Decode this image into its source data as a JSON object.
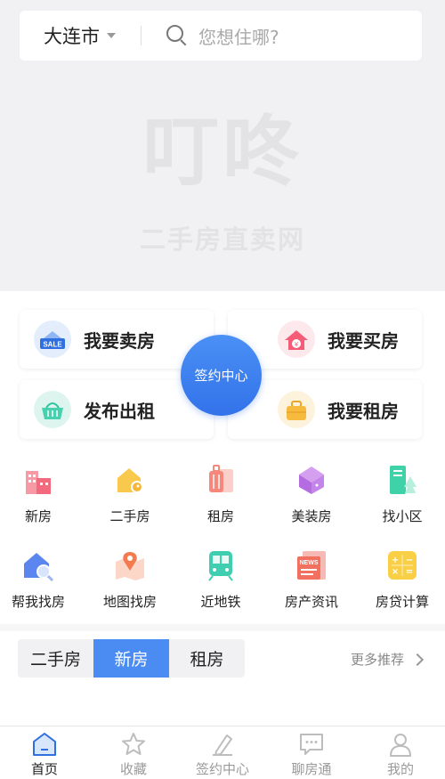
{
  "header": {
    "city": "大连市",
    "search_placeholder": "您想住哪?"
  },
  "brand": {
    "logo_text": "叮咚",
    "subtitle": "二手房直卖网"
  },
  "cards": [
    {
      "label": "我要卖房",
      "icon": "sale-icon"
    },
    {
      "label": "我要买房",
      "icon": "house-yen-icon"
    },
    {
      "label": "发布出租",
      "icon": "basket-icon"
    },
    {
      "label": "我要租房",
      "icon": "suitcase-icon"
    }
  ],
  "center_button": {
    "label": "签约中心"
  },
  "grid": [
    {
      "label": "新房",
      "icon": "buildings-icon"
    },
    {
      "label": "二手房",
      "icon": "house-key-icon"
    },
    {
      "label": "租房",
      "icon": "luggage-icon"
    },
    {
      "label": "美装房",
      "icon": "box-icon"
    },
    {
      "label": "找小区",
      "icon": "community-icon"
    },
    {
      "label": "帮我找房",
      "icon": "house-search-icon"
    },
    {
      "label": "地图找房",
      "icon": "map-pin-icon"
    },
    {
      "label": "近地铁",
      "icon": "subway-icon"
    },
    {
      "label": "房产资讯",
      "icon": "news-icon"
    },
    {
      "label": "房贷计算",
      "icon": "calculator-icon"
    }
  ],
  "recommend": {
    "tabs": [
      "二手房",
      "新房",
      "租房"
    ],
    "active_tab": "新房",
    "more_label": "更多推荐"
  },
  "bottom_nav": [
    {
      "label": "首页",
      "icon": "home-icon",
      "active": true
    },
    {
      "label": "收藏",
      "icon": "star-icon",
      "active": false
    },
    {
      "label": "签约中心",
      "icon": "sign-icon",
      "active": false
    },
    {
      "label": "聊房通",
      "icon": "chat-icon",
      "active": false
    },
    {
      "label": "我的",
      "icon": "user-icon",
      "active": false
    }
  ],
  "colors": {
    "accent": "#4a8cf2",
    "hero_bg": "#f1f1f3"
  }
}
